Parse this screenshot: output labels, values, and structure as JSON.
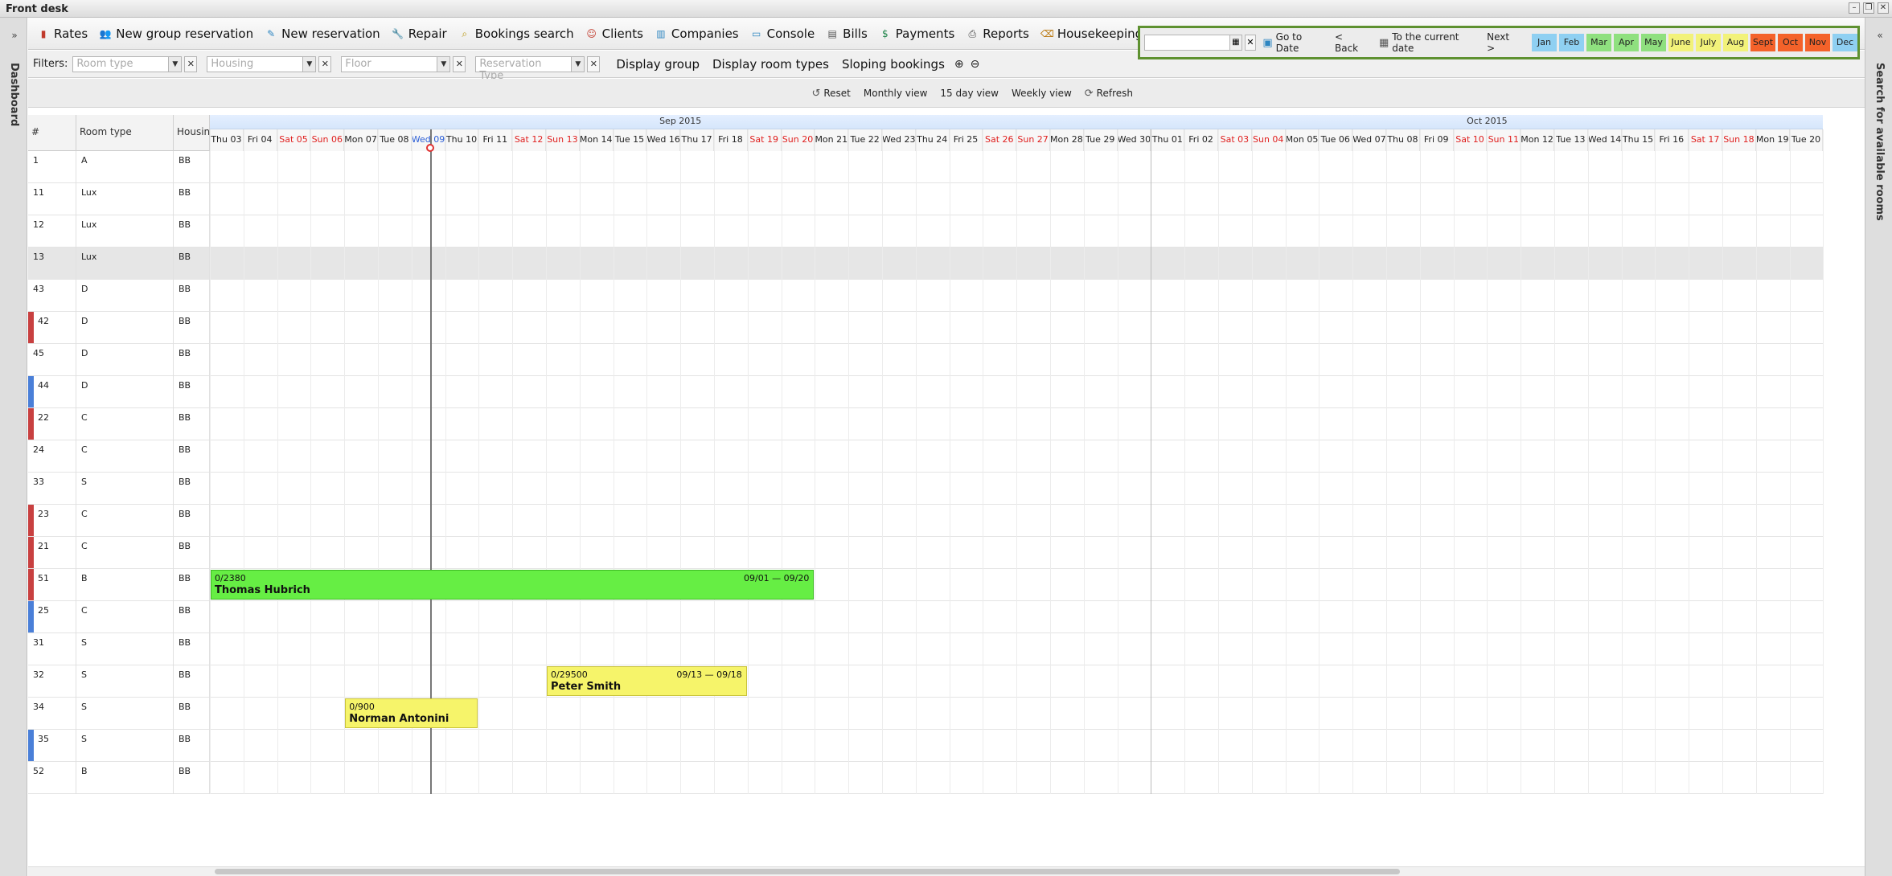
{
  "window": {
    "title": "Front desk"
  },
  "left_panel": {
    "label": "Dashboard",
    "toggle": "»"
  },
  "right_panel": {
    "label": "Search for available rooms",
    "toggle": "«"
  },
  "menu": [
    {
      "label": "Rates",
      "icon": "rates-icon",
      "glyph": "▮",
      "color": "#c0392b"
    },
    {
      "label": "New group reservation",
      "icon": "group-icon",
      "glyph": "👥",
      "color": "#d35400"
    },
    {
      "label": "New reservation",
      "icon": "pen-icon",
      "glyph": "✎",
      "color": "#2e86c1"
    },
    {
      "label": "Repair",
      "icon": "wrench-icon",
      "glyph": "🔧",
      "color": "#7f8c8d"
    },
    {
      "label": "Bookings search",
      "icon": "magnifier-icon",
      "glyph": "⌕",
      "color": "#b7950b"
    },
    {
      "label": "Clients",
      "icon": "clients-icon",
      "glyph": "☺",
      "color": "#c0392b"
    },
    {
      "label": "Companies",
      "icon": "building-icon",
      "glyph": "▥",
      "color": "#2e86c1"
    },
    {
      "label": "Console",
      "icon": "console-icon",
      "glyph": "▭",
      "color": "#2e86c1"
    },
    {
      "label": "Bills",
      "icon": "bills-icon",
      "glyph": "▤",
      "color": "#555"
    },
    {
      "label": "Payments",
      "icon": "dollar-icon",
      "glyph": "$",
      "color": "#1e8449"
    },
    {
      "label": "Reports",
      "icon": "printer-icon",
      "glyph": "⎙",
      "color": "#444"
    },
    {
      "label": "Housekeeping",
      "icon": "broom-icon",
      "glyph": "⌫",
      "color": "#b9770e"
    }
  ],
  "filters": {
    "label": "Filters:",
    "combos": [
      {
        "placeholder": "Room type"
      },
      {
        "placeholder": "Housing"
      },
      {
        "placeholder": "Floor"
      },
      {
        "placeholder": "Reservation Type"
      }
    ],
    "buttons": [
      "Display group",
      "Display room types",
      "Sloping bookings"
    ]
  },
  "nav": {
    "reset": "Reset",
    "monthly": "Monthly view",
    "fifteen": "15 day view",
    "weekly": "Weekly view",
    "refresh": "Refresh",
    "goto": "Go to Date",
    "back": "< Back",
    "current": "To the current date",
    "next": "Next >",
    "months": [
      {
        "label": "Jan",
        "color": "#8fd0f2"
      },
      {
        "label": "Feb",
        "color": "#8fd0f2"
      },
      {
        "label": "Mar",
        "color": "#8fe07f"
      },
      {
        "label": "Apr",
        "color": "#8fe07f"
      },
      {
        "label": "May",
        "color": "#8fe07f"
      },
      {
        "label": "June",
        "color": "#f2f27a"
      },
      {
        "label": "July",
        "color": "#f2f27a"
      },
      {
        "label": "Aug",
        "color": "#f2f27a"
      },
      {
        "label": "Sept",
        "color": "#f4622a"
      },
      {
        "label": "Oct",
        "color": "#f4622a"
      },
      {
        "label": "Nov",
        "color": "#f4622a"
      },
      {
        "label": "Dec",
        "color": "#8fd0f2"
      }
    ]
  },
  "grid": {
    "headers": {
      "num": "#",
      "type": "Room type",
      "housing": "Housing"
    },
    "months": [
      "Sep 2015",
      "Oct 2015"
    ],
    "days": [
      "Thu 03",
      "Fri 04",
      "Sat 05",
      "Sun 06",
      "Mon 07",
      "Tue 08",
      "Wed 09",
      "Thu 10",
      "Fri 11",
      "Sat 12",
      "Sun 13",
      "Mon 14",
      "Tue 15",
      "Wed 16",
      "Thu 17",
      "Fri 18",
      "Sat 19",
      "Sun 20",
      "Mon 21",
      "Tue 22",
      "Wed 23",
      "Thu 24",
      "Fri 25",
      "Sat 26",
      "Sun 27",
      "Mon 28",
      "Tue 29",
      "Wed 30",
      "Thu 01",
      "Fri 02",
      "Sat 03",
      "Sun 04",
      "Mon 05",
      "Tue 06",
      "Wed 07",
      "Thu 08",
      "Fri 09",
      "Sat 10",
      "Sun 11",
      "Mon 12",
      "Tue 13",
      "Wed 14",
      "Thu 15",
      "Fri 16",
      "Sat 17",
      "Sun 18",
      "Mon 19",
      "Tue 20"
    ],
    "rooms": [
      {
        "num": "1",
        "type": "A",
        "housing": "BB",
        "marker": ""
      },
      {
        "num": "11",
        "type": "Lux",
        "housing": "BB",
        "marker": ""
      },
      {
        "num": "12",
        "type": "Lux",
        "housing": "BB",
        "marker": ""
      },
      {
        "num": "13",
        "type": "Lux",
        "housing": "BB",
        "marker": "",
        "selected": true
      },
      {
        "num": "43",
        "type": "D",
        "housing": "BB",
        "marker": ""
      },
      {
        "num": "42",
        "type": "D",
        "housing": "BB",
        "marker": "#c84040"
      },
      {
        "num": "45",
        "type": "D",
        "housing": "BB",
        "marker": ""
      },
      {
        "num": "44",
        "type": "D",
        "housing": "BB",
        "marker": "#4a7fd8"
      },
      {
        "num": "22",
        "type": "C",
        "housing": "BB",
        "marker": "#c84040"
      },
      {
        "num": "24",
        "type": "C",
        "housing": "BB",
        "marker": ""
      },
      {
        "num": "33",
        "type": "S",
        "housing": "BB",
        "marker": ""
      },
      {
        "num": "23",
        "type": "C",
        "housing": "BB",
        "marker": "#c84040"
      },
      {
        "num": "21",
        "type": "C",
        "housing": "BB",
        "marker": "#c84040"
      },
      {
        "num": "51",
        "type": "B",
        "housing": "BB",
        "marker": "#c84040"
      },
      {
        "num": "25",
        "type": "C",
        "housing": "BB",
        "marker": "#4a7fd8"
      },
      {
        "num": "31",
        "type": "S",
        "housing": "BB",
        "marker": ""
      },
      {
        "num": "32",
        "type": "S",
        "housing": "BB",
        "marker": ""
      },
      {
        "num": "34",
        "type": "S",
        "housing": "BB",
        "marker": ""
      },
      {
        "num": "35",
        "type": "S",
        "housing": "BB",
        "marker": "#4a7fd8"
      },
      {
        "num": "52",
        "type": "B",
        "housing": "BB",
        "marker": ""
      }
    ],
    "today_index": 6,
    "bookings": [
      {
        "row": 13,
        "start": 0,
        "end": 17,
        "code": "0/2380",
        "name": "Thomas Hubrich",
        "dates": "09/01 — 09/20",
        "color": "#66ee44",
        "border": "#3dbb22"
      },
      {
        "row": 16,
        "start": 10,
        "end": 15,
        "code": "0/29500",
        "name": "Peter Smith",
        "dates": "09/13 — 09/18",
        "color": "#f6f46a",
        "border": "#c8c23a"
      },
      {
        "row": 17,
        "start": 4,
        "end": 7,
        "code": "0/900",
        "name": "Norman Antonini",
        "dates": "",
        "color": "#f6f46a",
        "border": "#c8c23a"
      }
    ]
  }
}
